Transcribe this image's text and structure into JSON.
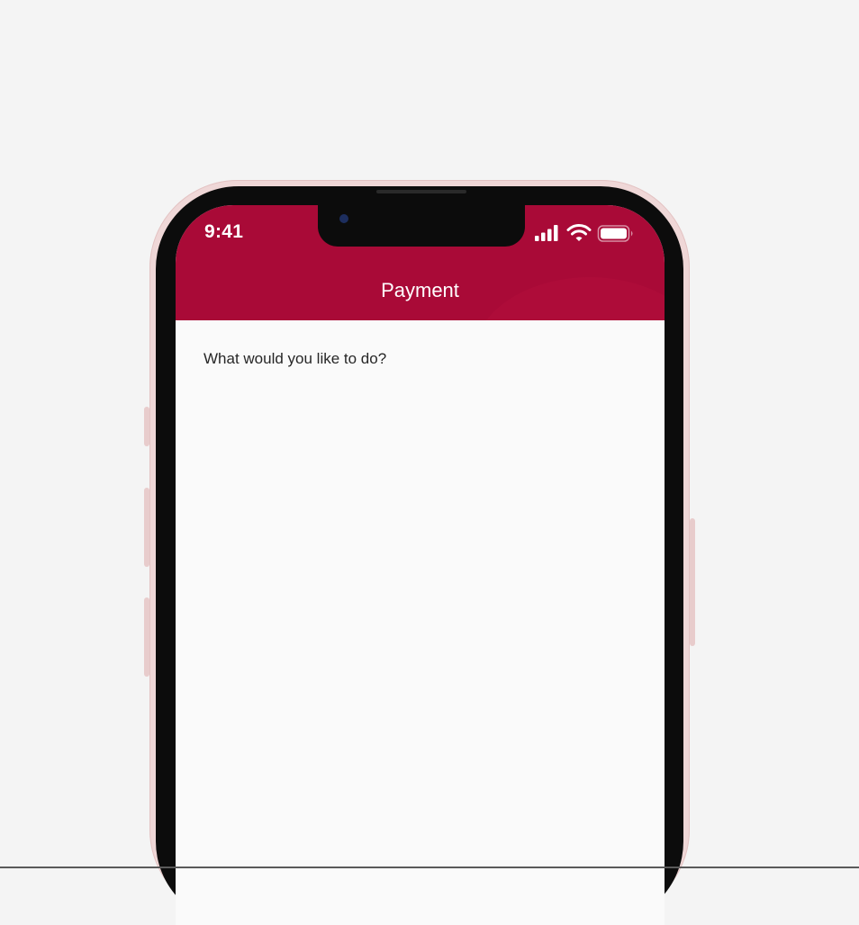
{
  "status_bar": {
    "time": "9:41",
    "icons": [
      "signal-icon",
      "wifi-icon",
      "battery-icon"
    ]
  },
  "header": {
    "title": "Payment"
  },
  "main": {
    "prompt": "What would you like to do?"
  },
  "colors": {
    "brand": "#a90a37",
    "background": "#fafafa",
    "text": "#262626"
  }
}
